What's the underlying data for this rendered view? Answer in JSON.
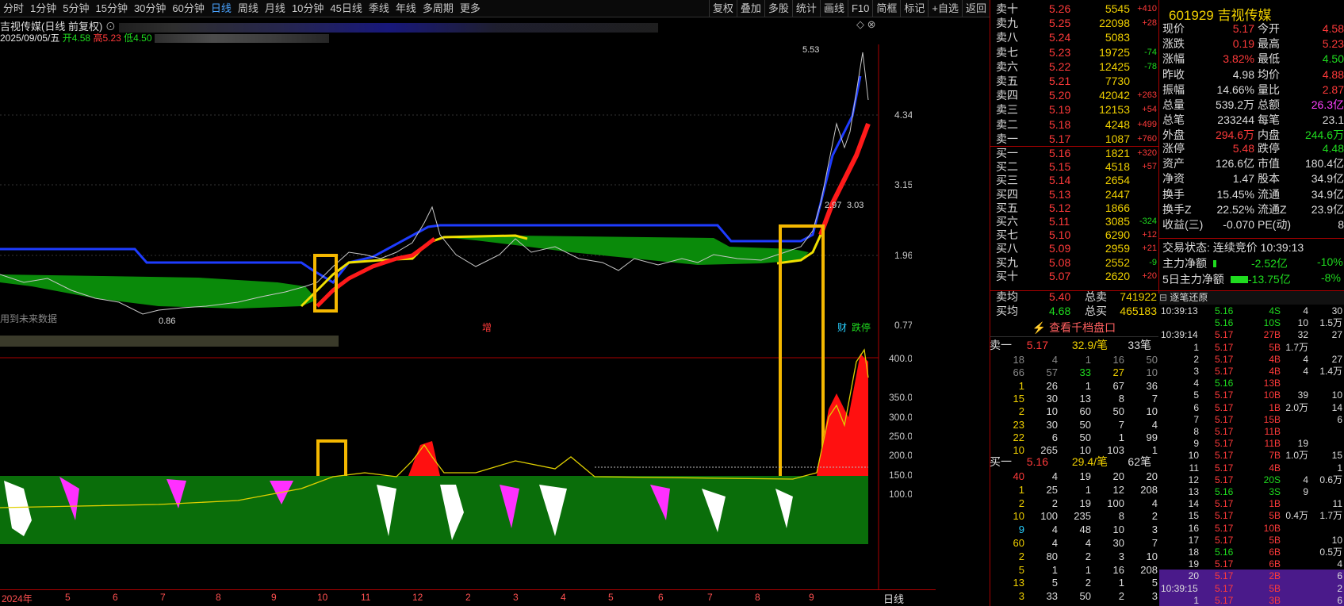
{
  "toolbar": {
    "periods": [
      "分时",
      "1分钟",
      "5分钟",
      "15分钟",
      "30分钟",
      "60分钟",
      "日线",
      "周线",
      "月线",
      "10分钟",
      "45日线",
      "季线",
      "年线",
      "多周期",
      "更多"
    ],
    "active": "日线",
    "tools": [
      "复权",
      "叠加",
      "多股",
      "统计",
      "画线",
      "F10",
      "简框",
      "标记",
      "+自选",
      "返回"
    ]
  },
  "chart_header": {
    "title": "吉视传媒(日线 前复权)",
    "date": "2025/09/05/五",
    "open_label": "开4.58",
    "high_label": "高5.23",
    "low_label": "低4.50"
  },
  "main_chart": {
    "price_labels": [
      "4.34",
      "3.15",
      "1.96",
      "0.77"
    ],
    "annotations": {
      "high": "5.53",
      "low": "0.86",
      "mid1": "2.97",
      "mid2": "3.03",
      "flag_zeng": "增",
      "flag_cai": "财",
      "flag_jiaoyi": "跌停",
      "notice": "用到未来数据"
    }
  },
  "sub_chart": {
    "labels": [
      "400.0",
      "350.0",
      "300.0",
      "250.0",
      "200.0",
      "150.0",
      "100.0"
    ]
  },
  "x_axis": {
    "labels": [
      "2024年",
      "5",
      "6",
      "7",
      "8",
      "9",
      "10",
      "11",
      "12",
      "2",
      "3",
      "4",
      "5",
      "6",
      "7",
      "8",
      "9"
    ],
    "period": "日线"
  },
  "quote": {
    "code": "601929",
    "name": "吉视传媒",
    "rows": [
      [
        "现价",
        "5.17",
        "今开",
        "4.58"
      ],
      [
        "涨跌",
        "0.19",
        "最高",
        "5.23"
      ],
      [
        "涨幅",
        "3.82%",
        "最低",
        "4.50"
      ],
      [
        "昨收",
        "4.98",
        "均价",
        "4.88"
      ],
      [
        "振幅",
        "14.66%",
        "量比",
        "2.87"
      ],
      [
        "总量",
        "539.2万",
        "总额",
        "26.3亿"
      ],
      [
        "总笔",
        "233244",
        "每笔",
        "23.1"
      ],
      [
        "外盘",
        "294.6万",
        "内盘",
        "244.6万"
      ],
      [
        "涨停",
        "5.48",
        "跌停",
        "4.48"
      ],
      [
        "资产",
        "126.6亿",
        "市值",
        "180.4亿"
      ],
      [
        "净资",
        "1.47",
        "股本",
        "34.9亿"
      ],
      [
        "换手",
        "15.45%",
        "流通",
        "34.9亿"
      ],
      [
        "换手Z",
        "22.52%",
        "流通Z",
        "23.9亿"
      ],
      [
        "收益(三)",
        "-0.070",
        "PE(动)",
        "8"
      ]
    ],
    "status": "交易状态: 连续竞价 10:39:13",
    "main_flow_label": "主力净额",
    "main_flow": "-2.52亿",
    "main_flow_pct": "-10%",
    "flow5_label": "5日主力净额",
    "flow5": "-13.75亿",
    "flow5_pct": "-8%"
  },
  "orderbook": {
    "asks": [
      [
        "卖十",
        "5.26",
        "5545",
        "+410"
      ],
      [
        "卖九",
        "5.25",
        "22098",
        "+28"
      ],
      [
        "卖八",
        "5.24",
        "5083",
        ""
      ],
      [
        "卖七",
        "5.23",
        "19725",
        "-74"
      ],
      [
        "卖六",
        "5.22",
        "12425",
        "-78"
      ],
      [
        "卖五",
        "5.21",
        "7730",
        ""
      ],
      [
        "卖四",
        "5.20",
        "42042",
        "+263"
      ],
      [
        "卖三",
        "5.19",
        "12153",
        "+54"
      ],
      [
        "卖二",
        "5.18",
        "4248",
        "+499"
      ],
      [
        "卖一",
        "5.17",
        "1087",
        "+760"
      ]
    ],
    "bids": [
      [
        "买一",
        "5.16",
        "1821",
        "+320"
      ],
      [
        "买二",
        "5.15",
        "4518",
        "+57"
      ],
      [
        "买三",
        "5.14",
        "2654",
        ""
      ],
      [
        "买四",
        "5.13",
        "2447",
        ""
      ],
      [
        "买五",
        "5.12",
        "1866",
        ""
      ],
      [
        "买六",
        "5.11",
        "3085",
        "-324"
      ],
      [
        "买七",
        "5.10",
        "6290",
        "+12"
      ],
      [
        "买八",
        "5.09",
        "2959",
        "+21"
      ],
      [
        "买九",
        "5.08",
        "2552",
        "-9"
      ],
      [
        "买十",
        "5.07",
        "2620",
        "+20"
      ]
    ],
    "avg_sell": [
      "卖均",
      "5.40",
      "总卖",
      "741922"
    ],
    "avg_buy": [
      "买均",
      "4.68",
      "总买",
      "465183"
    ],
    "link": "查看千档盘口"
  },
  "queue": {
    "sell1": [
      "卖一",
      "5.17",
      "32.9/笔",
      "33笔"
    ],
    "sell_rows": [
      [
        "18",
        "4",
        "1",
        "16",
        "50"
      ],
      [
        "66",
        "57",
        "33",
        "27",
        "10"
      ],
      [
        "1",
        "26",
        "1",
        "67",
        "36"
      ],
      [
        "15",
        "30",
        "13",
        "8",
        "7"
      ],
      [
        "2",
        "10",
        "60",
        "50",
        "10"
      ],
      [
        "23",
        "30",
        "50",
        "7",
        "4"
      ],
      [
        "22",
        "6",
        "50",
        "1",
        "99"
      ],
      [
        "10",
        "265",
        "10",
        "103",
        "1"
      ]
    ],
    "buy1": [
      "买一",
      "5.16",
      "29.4/笔",
      "62笔"
    ],
    "buy_rows": [
      [
        "40",
        "4",
        "19",
        "20",
        "20"
      ],
      [
        "1",
        "25",
        "1",
        "12",
        "208"
      ],
      [
        "2",
        "2",
        "19",
        "100",
        "4"
      ],
      [
        "10",
        "100",
        "235",
        "8",
        "2"
      ],
      [
        "9",
        "4",
        "48",
        "10",
        "3"
      ],
      [
        "60",
        "4",
        "4",
        "30",
        "7"
      ],
      [
        "2",
        "80",
        "2",
        "3",
        "10"
      ],
      [
        "5",
        "1",
        "1",
        "16",
        "208"
      ],
      [
        "13",
        "5",
        "2",
        "1",
        "5"
      ],
      [
        "3",
        "33",
        "50",
        "2",
        "3"
      ]
    ]
  },
  "ticks": {
    "title": "逐笔还原",
    "rows": [
      [
        "10:39:13",
        "5.16",
        "4S",
        "4",
        "30"
      ],
      [
        "",
        "5.16",
        "10S",
        "10",
        "1.5万"
      ],
      [
        "10:39:14",
        "5.17",
        "27B",
        "32",
        "27"
      ],
      [
        "1",
        "5.17",
        "5B",
        "1.7万",
        ""
      ],
      [
        "2",
        "5.17",
        "4B",
        "4",
        "27"
      ],
      [
        "3",
        "5.17",
        "4B",
        "4",
        "1.4万"
      ],
      [
        "4",
        "5.16",
        "13B",
        "",
        ""
      ],
      [
        "5",
        "5.17",
        "10B",
        "39",
        "10"
      ],
      [
        "6",
        "5.17",
        "1B",
        "2.0万",
        "14"
      ],
      [
        "7",
        "5.17",
        "15B",
        "",
        "6"
      ],
      [
        "8",
        "5.17",
        "11B",
        "",
        ""
      ],
      [
        "9",
        "5.17",
        "11B",
        "19",
        ""
      ],
      [
        "10",
        "5.17",
        "7B",
        "1.0万",
        "15"
      ],
      [
        "11",
        "5.17",
        "4B",
        "",
        "1"
      ],
      [
        "12",
        "5.17",
        "20S",
        "4",
        "0.6万"
      ],
      [
        "13",
        "5.16",
        "3S",
        "9",
        ""
      ],
      [
        "14",
        "5.17",
        "1B",
        "",
        "11"
      ],
      [
        "15",
        "5.17",
        "5B",
        "0.4万",
        "1.7万"
      ],
      [
        "16",
        "5.17",
        "10B",
        "",
        ""
      ],
      [
        "17",
        "5.17",
        "5B",
        "",
        "10"
      ],
      [
        "18",
        "5.16",
        "6B",
        "",
        "0.5万"
      ],
      [
        "19",
        "5.17",
        "6B",
        "",
        "4"
      ],
      [
        "20",
        "5.17",
        "2B",
        "",
        "6"
      ],
      [
        "10:39:15",
        "5.17",
        "5B",
        "",
        "2"
      ],
      [
        "1",
        "5.17",
        "3B",
        "",
        "6"
      ]
    ]
  }
}
